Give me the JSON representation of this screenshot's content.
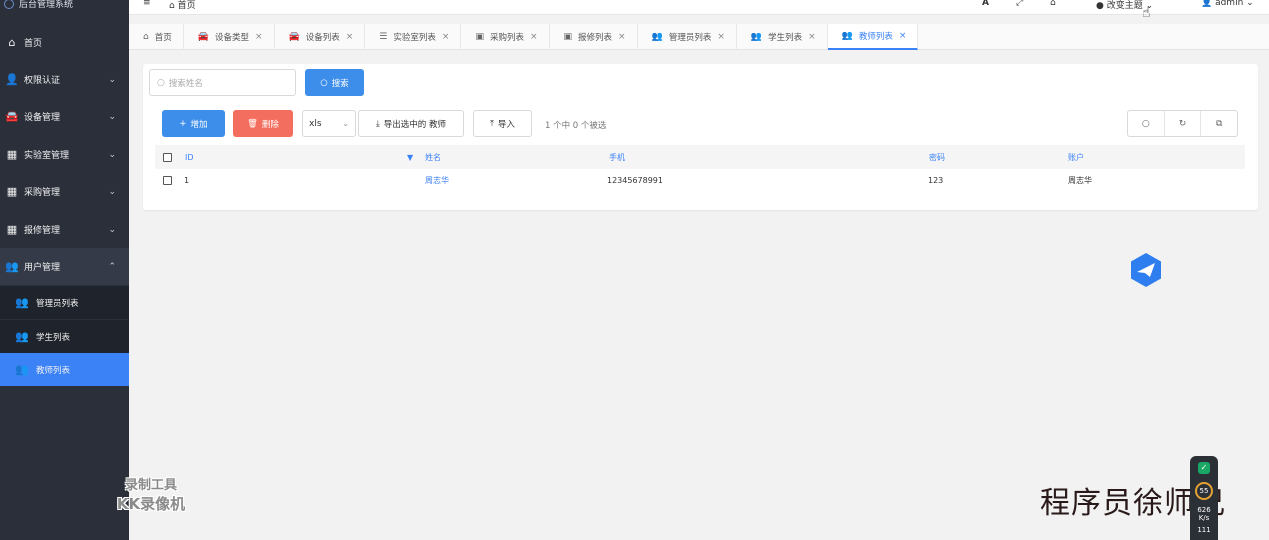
{
  "sidebar": {
    "brand": "后台管理系统",
    "items": [
      {
        "label": "首页",
        "icon": "home-icon"
      },
      {
        "label": "权限认证",
        "icon": "user-key-icon"
      },
      {
        "label": "设备管理",
        "icon": "car-icon"
      },
      {
        "label": "实验室管理",
        "icon": "table-icon"
      },
      {
        "label": "采购管理",
        "icon": "table-icon"
      },
      {
        "label": "报修管理",
        "icon": "table-icon"
      },
      {
        "label": "用户管理",
        "icon": "users-icon"
      }
    ],
    "subitems": [
      {
        "label": "管理员列表",
        "icon": "users-icon"
      },
      {
        "label": "学生列表",
        "icon": "users-icon"
      },
      {
        "label": "教师列表",
        "icon": "users-icon"
      }
    ]
  },
  "topbar": {
    "menu_glyph": "≡",
    "breadcrumb": "首页",
    "font_glyph": "A",
    "fullscreen_glyph": "⤢",
    "home_glyph": "⌂",
    "theme_label": "改变主题",
    "user_label": "admin"
  },
  "tabs": [
    {
      "label": "首页",
      "icon": "home-icon",
      "closable": false
    },
    {
      "label": "设备类型",
      "icon": "car-icon",
      "closable": true
    },
    {
      "label": "设备列表",
      "icon": "car-icon",
      "closable": true
    },
    {
      "label": "实验室列表",
      "icon": "list-icon",
      "closable": true
    },
    {
      "label": "采购列表",
      "icon": "image-icon",
      "closable": true
    },
    {
      "label": "报修列表",
      "icon": "image-icon",
      "closable": true
    },
    {
      "label": "管理员列表",
      "icon": "users-icon",
      "closable": true
    },
    {
      "label": "学生列表",
      "icon": "users-icon",
      "closable": true
    },
    {
      "label": "教师列表",
      "icon": "users-icon",
      "closable": true
    }
  ],
  "toolbar": {
    "search_placeholder": "搜索姓名",
    "search_button": "搜索",
    "add_button": "增加",
    "delete_button": "删除",
    "export_format": "xls",
    "export_button": "导出选中的 教师",
    "import_button": "导入",
    "selection_count": "1 个中 0 个被选"
  },
  "table": {
    "columns": [
      "ID",
      "姓名",
      "手机",
      "密码",
      "账户"
    ],
    "rows": [
      {
        "id": "1",
        "name": "周志华",
        "phone": "12345678991",
        "password": "123",
        "account": "周志华"
      }
    ]
  },
  "overlays": {
    "tool_watermark_1": "录制工具",
    "tool_watermark_2": "KK录像机",
    "author_watermark": "程序员徐师兄",
    "speed_value": "55",
    "speed_up": "626",
    "speed_unit": "K/s",
    "speed_down": "111"
  },
  "colors": {
    "sidebar_bg": "#2a2f3a",
    "accent": "#3b82f6",
    "danger": "#f46e5f"
  }
}
